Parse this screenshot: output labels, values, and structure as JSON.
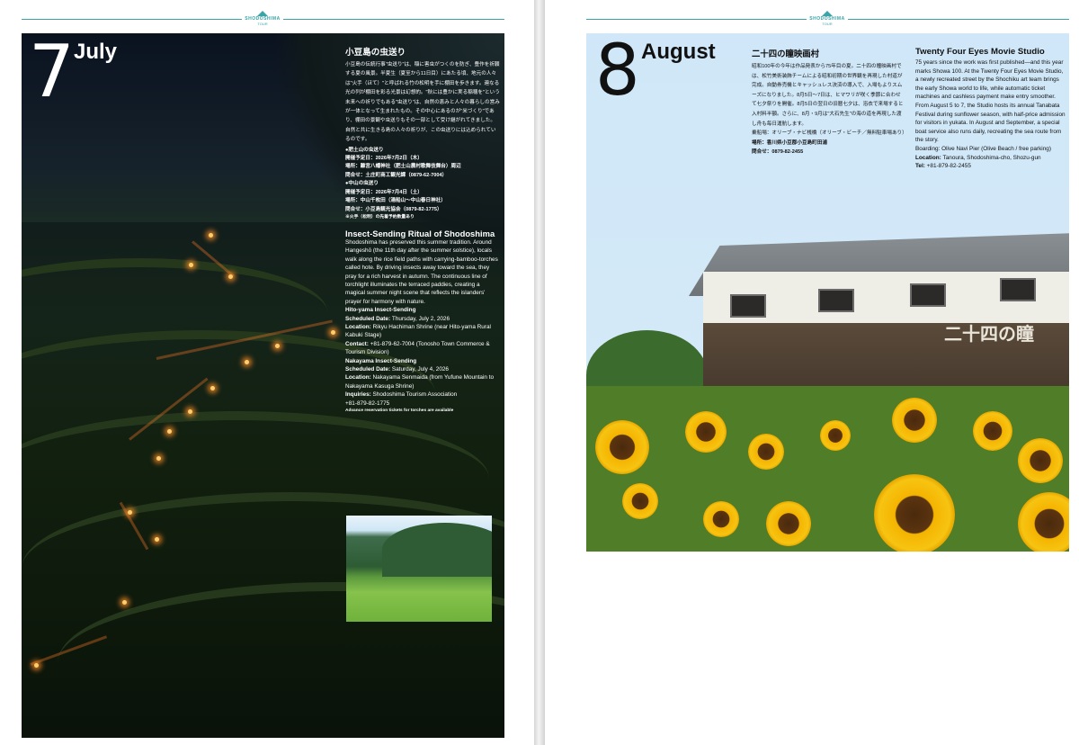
{
  "brand": {
    "logo_line1": "SHODOSHIMA",
    "logo_line2": "TOUR",
    "accent": "#3aa4a7"
  },
  "july": {
    "num": "7",
    "name": "July",
    "jp_title": "小豆島の虫送り",
    "jp_body": "小豆島の伝統行事\"虫送り\"は、稲に害虫がつくのを防ぎ、豊作を祈願する夏の風景。半夏生（夏至から11日目）にあたる頃、地元の人々は\"火手（ほて）\"と呼ばれる竹の松明を手に棚田を歩きます。連なる光の列が棚田を彩る光景は幻想的。\"秋には豊かに実る稲穂を\"という未来への祈りでもある\"虫送り\"は、自然の恵みと人々の暮らしの営みが一体となって生まれたもの。その中心にあるのが\"米づくり\"であり、棚田の景観や虫送りもその一部として受け継がれてきました。自然と共に生きる島の人々の祈りが、この虫送りには込められているのです。",
    "jp_events": [
      "●肥土山の虫送り",
      "開催予定日：2026年7月2日（木）",
      "場所：離宮八幡神社（肥土山農村歌舞伎舞台）周辺",
      "問合せ：土庄町商工観光課（0879-62-7004）",
      "●中山の虫送り",
      "開催予定日：2026年7月4日（土）",
      "場所：中山千枚田（湯船山〜中山春日神社）",
      "問合せ：小豆島観光協会（0879-82-1775）",
      "※火手（松明）の先着予約数量あり"
    ],
    "en_title": "Insect-Sending Ritual of Shodoshima",
    "en_body": "Shodoshima has preserved this summer tradition. Around Hangeshō (the 11th day after the summer solstice), locals walk along the rice field paths with carrying-bamboo-torches called hote. By driving insects away toward the sea, they pray for a rich harvest in autumn. The continuous line of torchlight illuminates the terraced paddies, creating a magical summer night scene that reflects the islanders' prayer for harmony with nature.",
    "en_events": [
      {
        "label": "",
        "text": "Hito-yama Insect-Sending",
        "bold": true
      },
      {
        "label": "Scheduled Date: ",
        "text": "Thursday, July 2, 2026"
      },
      {
        "label": "Location: ",
        "text": "Rikyu Hachiman Shrine (near Hito-yama Rural Kabuki Stage)"
      },
      {
        "label": "Contact: ",
        "text": "+81-879-62-7004 (Tonosho Town Commerce & Tourism Division)"
      },
      {
        "label": "",
        "text": "Nakayama Insect-Sending",
        "bold": true
      },
      {
        "label": "Scheduled Date: ",
        "text": "Saturday, July 4, 2026"
      },
      {
        "label": "Location: ",
        "text": "Nakayama Senmaida (from Yufune Mountain to Nakayama Kasuga Shrine)"
      },
      {
        "label": "Inquiries: ",
        "text": "Shodoshima Tourism Association"
      },
      {
        "label": "",
        "text": "+81-879-82-1775"
      }
    ],
    "note": "Advance reservation tickets for torches are available"
  },
  "august": {
    "num": "8",
    "name": "August",
    "jp_title": "二十四の瞳映画村",
    "jp_body": "昭和100年の今年は作品発表から75年目の夏。二十四の瞳映画村では、松竹美術装飾チームによる昭和初期の世界観を再現した村道が完成。自動券売機とキャッシュレス決済の導入で、入場もよりスムーズになりました。8月5日〜7日は、ヒマワリが咲く季節に合わせて七夕祭りを開催。8月5日の翌日の旧暦七夕は、浴衣で来場すると入村料半額。さらに、8月・9月は\"大石先生\"の海の道を再現した渡し舟も毎日運航します。",
    "jp_access": "乗船場：オリーブ・ナビ桟橋（オリーブ・ビーチ／無料駐車場あり）",
    "jp_place": "場所：香川県小豆郡小豆島町田浦",
    "jp_contact": "問合せ：0879-82-2455",
    "en_title": "Twenty Four Eyes Movie Studio",
    "en_body1": "75 years since the work was first published—and this year marks Showa 100. At the Twenty Four Eyes Movie Studio, a newly recreated street by the Shochiku art team brings the early Showa world to life, while automatic ticket machines and cashless payment make entry smoother.",
    "en_body2": "From August 5 to 7, the Studio hosts its annual Tanabata Festival during sunflower season, with half-price admission for visitors in yukata. In August and September, a special boat service also runs daily, recreating the sea route from the story.",
    "en_boarding": "Boarding: Olive Navi Pier (Olive Beach / free parking)",
    "en_location_label": "Location: ",
    "en_location": "Tanoura, Shodoshima-cho, Shozu-gun",
    "en_tel_label": "Tel: ",
    "en_tel": "+81-879-82-2455",
    "sign_text": "二十四の瞳"
  }
}
